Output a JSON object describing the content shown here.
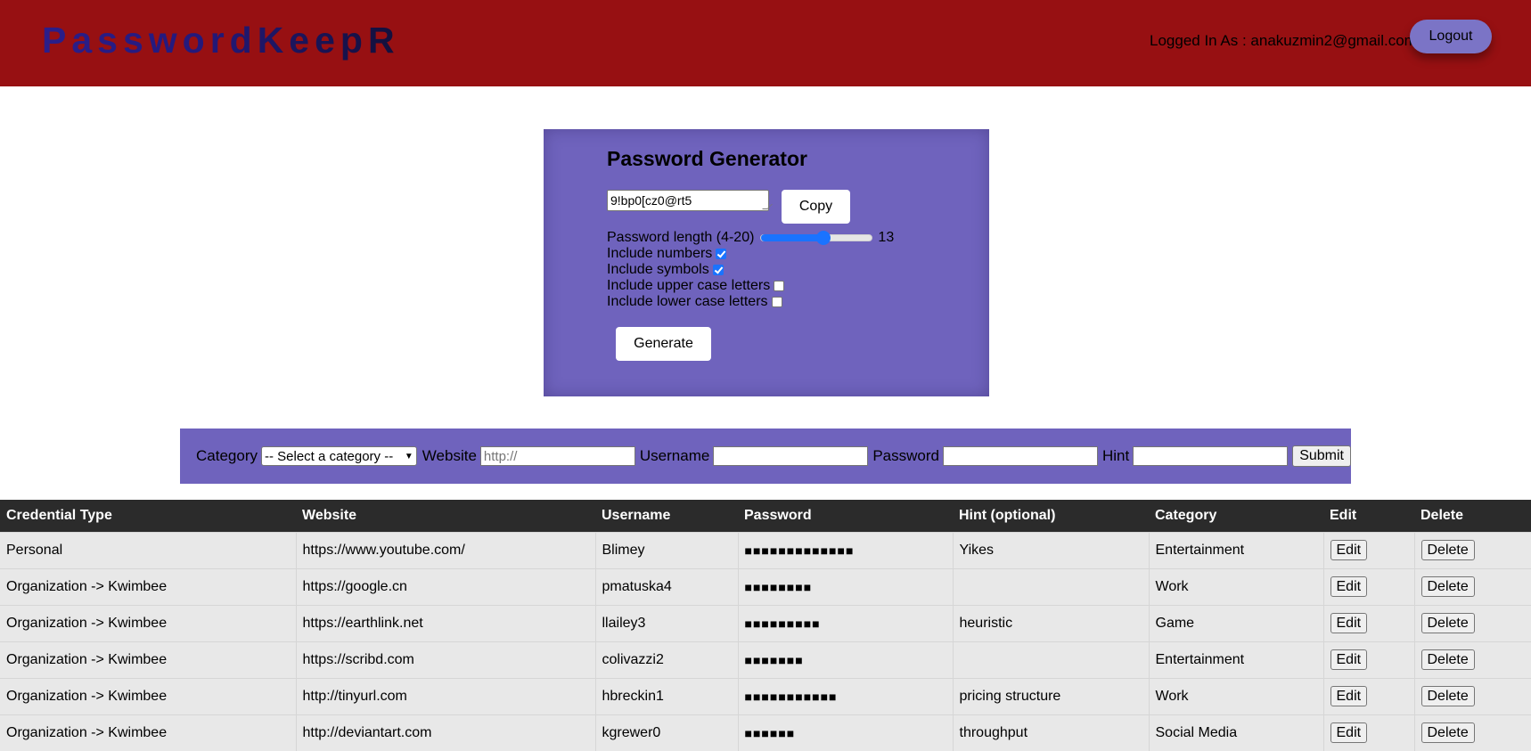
{
  "header": {
    "brand": "PasswordKeepR",
    "logged_in": "Logged In As : anakuzmin2@gmail.com",
    "logout_label": "Logout"
  },
  "generator": {
    "title": "Password Generator",
    "password": "9!bp0[cz0@rt5",
    "copy_label": "Copy",
    "length_label": "Password length (4-20)",
    "length_min": 4,
    "length_max": 20,
    "length_value": "13",
    "opt_numbers": "Include numbers",
    "opt_symbols": "Include symbols",
    "opt_upper": "Include upper case letters",
    "opt_lower": "Include lower case letters",
    "numbers_checked": true,
    "symbols_checked": true,
    "upper_checked": false,
    "lower_checked": false,
    "generate_label": "Generate"
  },
  "form": {
    "category_label": "Category",
    "category_selected": "-- Select a category --",
    "website_label": "Website",
    "website_placeholder": "http://",
    "username_label": "Username",
    "password_label": "Password",
    "hint_label": "Hint",
    "submit_label": "Submit"
  },
  "table": {
    "headers": [
      "Credential Type",
      "Website",
      "Username",
      "Password",
      "Hint (optional)",
      "Category",
      "Edit",
      "Delete"
    ],
    "edit_label": "Edit",
    "delete_label": "Delete",
    "rows": [
      {
        "type": "Personal",
        "website": "https://www.youtube.com/",
        "username": "Blimey",
        "password": "■■■■■■■■■■■■■",
        "hint": "Yikes",
        "category": "Entertainment"
      },
      {
        "type": "Organization -> Kwimbee",
        "website": "https://google.cn",
        "username": "pmatuska4",
        "password": "■■■■■■■■",
        "hint": "",
        "category": "Work"
      },
      {
        "type": "Organization -> Kwimbee",
        "website": "https://earthlink.net",
        "username": "llailey3",
        "password": "■■■■■■■■■",
        "hint": "heuristic",
        "category": "Game"
      },
      {
        "type": "Organization -> Kwimbee",
        "website": "https://scribd.com",
        "username": "colivazzi2",
        "password": "■■■■■■■",
        "hint": "",
        "category": "Entertainment"
      },
      {
        "type": "Organization -> Kwimbee",
        "website": "http://tinyurl.com",
        "username": "hbreckin1",
        "password": "■■■■■■■■■■■",
        "hint": "pricing structure",
        "category": "Work"
      },
      {
        "type": "Organization -> Kwimbee",
        "website": "http://deviantart.com",
        "username": "kgrewer0",
        "password": "■■■■■■",
        "hint": "throughput",
        "category": "Social Media"
      }
    ]
  }
}
